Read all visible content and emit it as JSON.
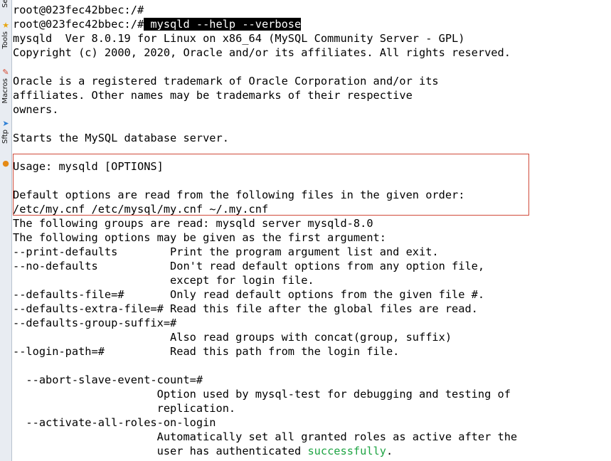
{
  "sidebar": {
    "tabs": [
      {
        "label": "Sess",
        "icon": "sessions-icon"
      },
      {
        "label": "Tools",
        "icon": "tools-icon"
      },
      {
        "label": "Macros",
        "icon": "macros-icon"
      },
      {
        "label": "Sftp",
        "icon": "sftp-icon"
      }
    ]
  },
  "terminal": {
    "prompt1": "root@023fec42bbec:/#",
    "prompt2": "root@023fec42bbec:/#",
    "command": " mysqld --help --verbose",
    "lines": [
      "mysqld  Ver 8.0.19 for Linux on x86_64 (MySQL Community Server - GPL)",
      "Copyright (c) 2000, 2020, Oracle and/or its affiliates. All rights reserved.",
      "",
      "Oracle is a registered trademark of Oracle Corporation and/or its",
      "affiliates. Other names may be trademarks of their respective",
      "owners.",
      "",
      "Starts the MySQL database server.",
      "",
      "Usage: mysqld [OPTIONS]",
      "",
      "Default options are read from the following files in the given order:",
      "/etc/my.cnf /etc/mysql/my.cnf ~/.my.cnf",
      "The following groups are read: mysqld server mysqld-8.0",
      "The following options may be given as the first argument:",
      "--print-defaults        Print the program argument list and exit.",
      "--no-defaults           Don't read default options from any option file,",
      "                        except for login file.",
      "--defaults-file=#       Only read default options from the given file #.",
      "--defaults-extra-file=# Read this file after the global files are read.",
      "--defaults-group-suffix=#",
      "                        Also read groups with concat(group, suffix)",
      "--login-path=#          Read this path from the login file.",
      "",
      "  --abort-slave-event-count=#",
      "                      Option used by mysql-test for debugging and testing of",
      "                      replication.",
      "  --activate-all-roles-on-login",
      "                      Automatically set all granted roles as active after the"
    ],
    "last_line_pre": "                      user has authenticated ",
    "last_line_green": "successfully",
    "last_line_post": "."
  },
  "colors": {
    "success_text": "#1ea443",
    "highlight_box": "#d04a3a"
  }
}
